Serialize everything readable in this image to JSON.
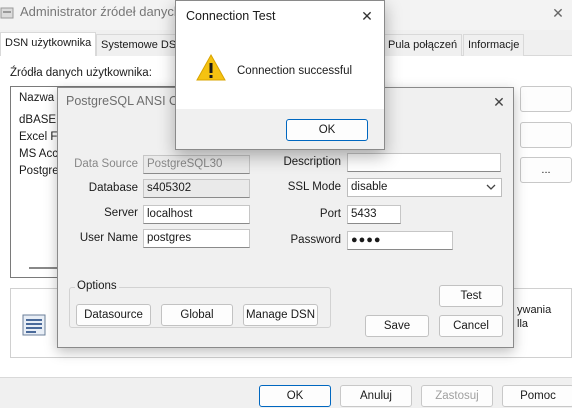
{
  "admin_window": {
    "title": "Administrator źródeł danych",
    "close_glyph": "✕",
    "tabs": [
      {
        "label": "DSN użytkownika"
      },
      {
        "label": "Systemowe DSN"
      },
      {
        "label": "Pula połączeń"
      },
      {
        "label": "Informacje"
      }
    ],
    "user_sources_label": "Źródła danych użytkownika:",
    "list": {
      "header": "Nazwa",
      "rows": [
        "dBASE Files",
        "Excel Files",
        "MS Access Database",
        "PostgreSQL30"
      ]
    },
    "side_button": "...",
    "info_text_line1": "ywania",
    "info_text_line2": "lla",
    "buttons": {
      "ok": "OK",
      "cancel": "Anuluj",
      "apply": "Zastosuj",
      "help": "Pomoc"
    }
  },
  "pg_dialog": {
    "title": "PostgreSQL ANSI ODBC Driver (psqlODBC) Setup",
    "close_glyph": "✕",
    "fields": {
      "data_source_label": "Data Source",
      "data_source_value": "PostgreSQL30",
      "database_label": "Database",
      "database_value": "s405302",
      "server_label": "Server",
      "server_value": "localhost",
      "username_label": "User Name",
      "username_value": "postgres",
      "description_label": "Description",
      "description_value": "",
      "sslmode_label": "SSL Mode",
      "sslmode_value": "disable",
      "port_label": "Port",
      "port_value": "5433",
      "password_label": "Password",
      "password_value": "●●●●"
    },
    "options_label": "Options",
    "buttons": {
      "datasource": "Datasource",
      "global": "Global",
      "manage_dsn": "Manage DSN",
      "test": "Test",
      "save": "Save",
      "cancel": "Cancel"
    }
  },
  "connection_test": {
    "title": "Connection Test",
    "close_glyph": "✕",
    "message": "Connection successful",
    "ok_label": "OK",
    "icon": "warning-icon",
    "icon_color": "#f5c211"
  }
}
